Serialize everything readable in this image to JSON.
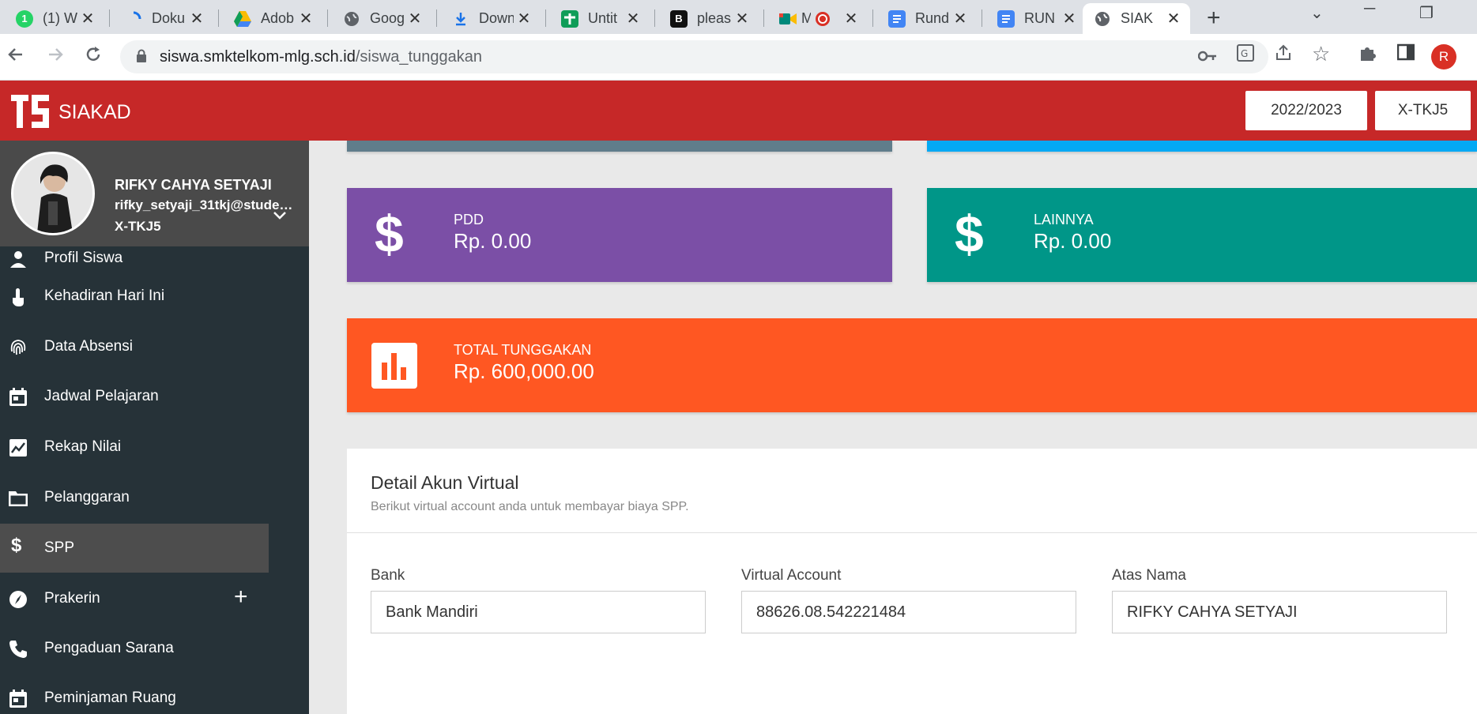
{
  "browser": {
    "tabs": [
      {
        "title": "(1) W",
        "icon": "whatsapp-icon",
        "color": "#25d366"
      },
      {
        "title": "Doku",
        "icon": "loading-icon",
        "color": "#1a73e8"
      },
      {
        "title": "Adob",
        "icon": "google-drive-icon",
        "color": "#fbbc04"
      },
      {
        "title": "Goog",
        "icon": "globe-icon",
        "color": "#5f6368"
      },
      {
        "title": "Down",
        "icon": "download-icon",
        "color": "#1a73e8"
      },
      {
        "title": "Untit",
        "icon": "google-sheets-icon",
        "color": "#0f9d58"
      },
      {
        "title": "pleas",
        "icon": "b-icon",
        "color": "#111111"
      },
      {
        "title": "M",
        "icon": "google-meet-icon",
        "color": "#00897b"
      },
      {
        "title": "Rund",
        "icon": "google-docs-icon",
        "color": "#4285f4"
      },
      {
        "title": "RUN",
        "icon": "google-docs-icon",
        "color": "#4285f4"
      },
      {
        "title": "SIAK",
        "icon": "globe-icon",
        "color": "#5f6368"
      }
    ],
    "url_host": "siswa.smktelkom-mlg.sch.id",
    "url_path": "/siswa_tunggakan",
    "profile_initial": "R"
  },
  "app": {
    "brand": "SIAKAD",
    "year": "2022/2023",
    "class_badge": "X-TKJ5"
  },
  "user": {
    "name": "RIFKY CAHYA SETYAJI",
    "email": "rifky_setyaji_31tkj@studen...",
    "class": "X-TKJ5"
  },
  "menu": [
    {
      "label": "Profil Siswa",
      "icon": "profile-icon"
    },
    {
      "label": "Kehadiran Hari Ini",
      "icon": "touch-icon"
    },
    {
      "label": "Data Absensi",
      "icon": "fingerprint-icon"
    },
    {
      "label": "Jadwal Pelajaran",
      "icon": "calendar-icon"
    },
    {
      "label": "Rekap Nilai",
      "icon": "chart-icon"
    },
    {
      "label": "Pelanggaran",
      "icon": "folder-icon"
    },
    {
      "label": "SPP",
      "icon": "dollar-icon",
      "active": true
    },
    {
      "label": "Prakerin",
      "icon": "compass-icon",
      "expandable": "+"
    },
    {
      "label": "Pengaduan Sarana",
      "icon": "phone-icon"
    },
    {
      "label": "Peminjaman Ruang",
      "icon": "calendar-icon"
    }
  ],
  "cards": {
    "pdd": {
      "label": "PDD",
      "value": "Rp. 0.00",
      "color": "#7b4fa6"
    },
    "lainnya": {
      "label": "LAINNYA",
      "value": "Rp. 0.00",
      "color": "#009688"
    },
    "total": {
      "label": "TOTAL TUNGGAKAN",
      "value": "Rp. 600,000.00",
      "color": "#ff5722"
    },
    "top_left_color": "#607d8b",
    "top_right_color": "#03a9f4"
  },
  "virtual_account": {
    "title": "Detail Akun Virtual",
    "subtitle": "Berikut virtual account anda untuk membayar biaya SPP.",
    "bank_label": "Bank",
    "bank_value": "Bank Mandiri",
    "va_label": "Virtual Account",
    "va_value": "88626.08.542221484",
    "name_label": "Atas Nama",
    "name_value": "RIFKY CAHYA SETYAJI"
  },
  "colors": {
    "appbar": "#c62828",
    "sidebar": "#263238"
  }
}
